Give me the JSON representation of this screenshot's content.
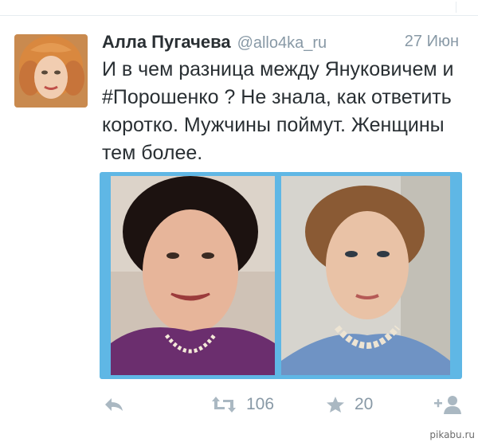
{
  "tweet": {
    "author_name": "Алла Пугачева",
    "author_handle": "@allo4ka_ru",
    "timestamp": "27 Июн",
    "text": "И в чем разница между Януковичем и #Порошенко ? Не знала, как ответить коротко. Мужчины поймут. Женщины тем более.",
    "avatar_icon": "avatar-portrait",
    "media": [
      {
        "name": "photo-left"
      },
      {
        "name": "photo-right"
      }
    ]
  },
  "actions": {
    "reply_icon": "reply-icon",
    "retweet_icon": "retweet-icon",
    "retweet_count": "106",
    "favorite_icon": "star-icon",
    "favorite_count": "20",
    "follow_icon": "follow-icon"
  },
  "watermark": "pikabu.ru",
  "colors": {
    "accent_blue": "#5fb7e5",
    "muted_gray": "#8899a6",
    "text": "#292f33",
    "icon_gray": "#aab8c2"
  }
}
